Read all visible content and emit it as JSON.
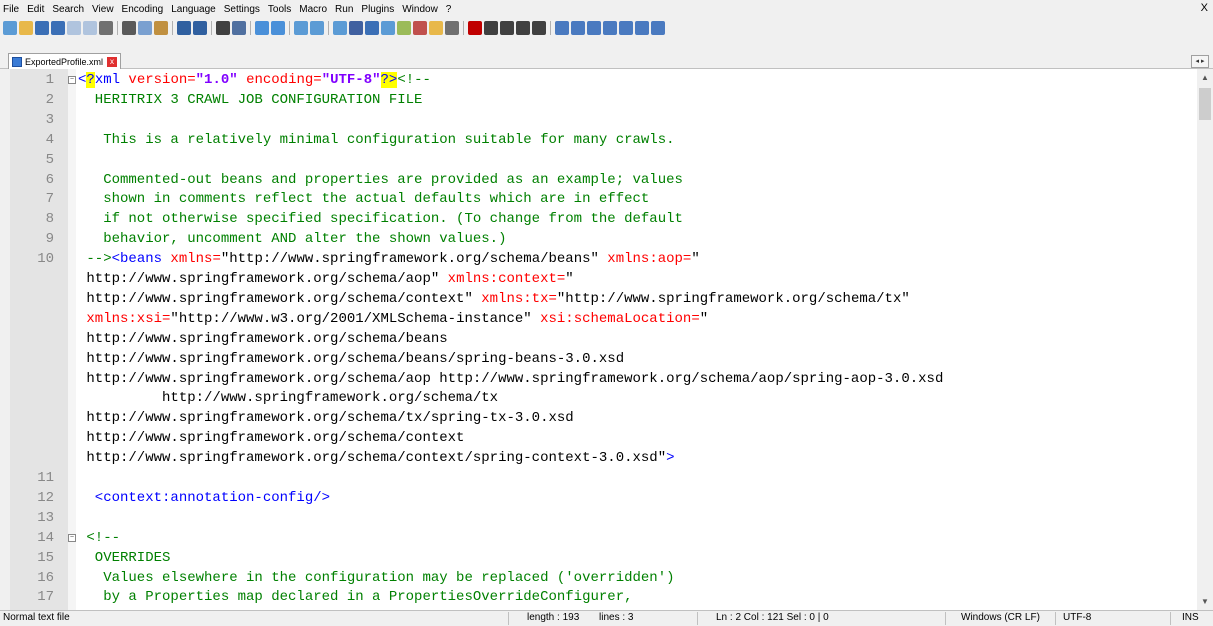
{
  "menu": [
    "File",
    "Edit",
    "Search",
    "View",
    "Encoding",
    "Language",
    "Settings",
    "Tools",
    "Macro",
    "Run",
    "Plugins",
    "Window",
    "?"
  ],
  "window_close": "X",
  "toolbar_icons": [
    {
      "name": "new-file-icon",
      "color": "#5b9bd5"
    },
    {
      "name": "open-file-icon",
      "color": "#e8b84a"
    },
    {
      "name": "save-icon",
      "color": "#3b6fb6"
    },
    {
      "name": "save-all-icon",
      "color": "#3b6fb6"
    },
    {
      "name": "close-icon",
      "color": "#b0c4de"
    },
    {
      "name": "close-all-icon",
      "color": "#b0c4de"
    },
    {
      "name": "print-icon",
      "color": "#707070"
    },
    {
      "sep": true
    },
    {
      "name": "cut-icon",
      "color": "#5a5a5a"
    },
    {
      "name": "copy-icon",
      "color": "#7aa0d0"
    },
    {
      "name": "paste-icon",
      "color": "#c09040"
    },
    {
      "sep": true
    },
    {
      "name": "undo-icon",
      "color": "#3060a0"
    },
    {
      "name": "redo-icon",
      "color": "#3060a0"
    },
    {
      "sep": true
    },
    {
      "name": "find-icon",
      "color": "#404040"
    },
    {
      "name": "replace-icon",
      "color": "#5070a0"
    },
    {
      "sep": true
    },
    {
      "name": "zoom-in-icon",
      "color": "#4a90d9"
    },
    {
      "name": "zoom-out-icon",
      "color": "#4a90d9"
    },
    {
      "sep": true
    },
    {
      "name": "sync-vertical-icon",
      "color": "#5b9bd5"
    },
    {
      "name": "sync-horizontal-icon",
      "color": "#5b9bd5"
    },
    {
      "sep": true
    },
    {
      "name": "word-wrap-icon",
      "color": "#5b9bd5"
    },
    {
      "name": "show-all-chars-icon",
      "color": "#4060a0"
    },
    {
      "name": "indent-guide-icon",
      "color": "#3b6fb6"
    },
    {
      "name": "doc-map-icon",
      "color": "#5b9bd5"
    },
    {
      "name": "function-list-icon",
      "color": "#9bbb59"
    },
    {
      "name": "folder-workspace-icon",
      "color": "#c0504d"
    },
    {
      "name": "monitoring-icon",
      "color": "#e8b84a"
    },
    {
      "name": "view-icon",
      "color": "#707070"
    },
    {
      "sep": true
    },
    {
      "name": "record-macro-icon",
      "color": "#c00000"
    },
    {
      "name": "stop-record-icon",
      "color": "#404040"
    },
    {
      "name": "playback-icon",
      "color": "#404040"
    },
    {
      "name": "run-macro-multiple-icon",
      "color": "#404040"
    },
    {
      "name": "save-macro-icon",
      "color": "#404040"
    },
    {
      "sep": true
    },
    {
      "name": "plugin-a-icon",
      "color": "#4a7ac0"
    },
    {
      "name": "plugin-b-icon",
      "color": "#4a7ac0"
    },
    {
      "name": "plugin-c-icon",
      "color": "#4a7ac0"
    },
    {
      "name": "plugin-d-icon",
      "color": "#4a7ac0"
    },
    {
      "name": "plugin-e-icon",
      "color": "#4a7ac0"
    },
    {
      "name": "plugin-f-icon",
      "color": "#4a7ac0"
    },
    {
      "name": "plugin-g-icon",
      "color": "#4a7ac0"
    }
  ],
  "tab": {
    "label": "ExportedProfile.xml",
    "close_label": "x",
    "scroll_arrows": "◂ ▸"
  },
  "scroll": {
    "up": "▲",
    "down": "▼"
  },
  "lines": [
    {
      "n": "1",
      "fold": "−",
      "segs": [
        {
          "t": "<",
          "c": "c-tag"
        },
        {
          "t": "?",
          "c": "c-tag hl"
        },
        {
          "t": "xml",
          "c": "c-tag"
        },
        {
          "t": " version=",
          "c": "c-attr"
        },
        {
          "t": "\"1.0\"",
          "c": "c-val"
        },
        {
          "t": " encoding=",
          "c": "c-attr"
        },
        {
          "t": "\"UTF-8\"",
          "c": "c-val"
        },
        {
          "t": "?>",
          "c": "c-tag hl"
        },
        {
          "t": "<!--",
          "c": "c-comment"
        }
      ]
    },
    {
      "n": "2",
      "segs": [
        {
          "t": "  HERITRIX 3 CRAWL JOB CONFIGURATION FILE",
          "c": "c-comment"
        }
      ]
    },
    {
      "n": "3",
      "segs": []
    },
    {
      "n": "4",
      "segs": [
        {
          "t": "   This is a relatively minimal configuration suitable for many crawls.",
          "c": "c-comment"
        }
      ]
    },
    {
      "n": "5",
      "segs": []
    },
    {
      "n": "6",
      "segs": [
        {
          "t": "   Commented-out beans and properties are provided as an example; values",
          "c": "c-comment"
        }
      ]
    },
    {
      "n": "7",
      "segs": [
        {
          "t": "   shown in comments reflect the actual defaults which are in effect",
          "c": "c-comment"
        }
      ]
    },
    {
      "n": "8",
      "segs": [
        {
          "t": "   if not otherwise specified specification. (To change from the default",
          "c": "c-comment"
        }
      ]
    },
    {
      "n": "9",
      "segs": [
        {
          "t": "   behavior, uncomment AND alter the shown values.)",
          "c": "c-comment"
        }
      ]
    },
    {
      "n": "10",
      "segs": [
        {
          "t": " -->",
          "c": "c-comment"
        },
        {
          "t": "<beans",
          "c": "c-tag"
        },
        {
          "t": " xmlns=",
          "c": "c-attr"
        },
        {
          "t": "\"http://www.springframework.org/schema/beans\"",
          "c": "c-plain"
        },
        {
          "t": " xmlns:aop=",
          "c": "c-attr"
        },
        {
          "t": "\"",
          "c": "c-plain"
        }
      ]
    },
    {
      "n": "",
      "segs": [
        {
          "t": " http://www.springframework.org/schema/aop\"",
          "c": "c-plain"
        },
        {
          "t": " xmlns:context=",
          "c": "c-attr"
        },
        {
          "t": "\"",
          "c": "c-plain"
        }
      ]
    },
    {
      "n": "",
      "segs": [
        {
          "t": " http://www.springframework.org/schema/context\"",
          "c": "c-plain"
        },
        {
          "t": " xmlns:tx=",
          "c": "c-attr"
        },
        {
          "t": "\"http://www.springframework.org/schema/tx\"",
          "c": "c-plain"
        }
      ]
    },
    {
      "n": "",
      "segs": [
        {
          "t": " xmlns:xsi=",
          "c": "c-attr"
        },
        {
          "t": "\"http://www.w3.org/2001/XMLSchema-instance\"",
          "c": "c-plain"
        },
        {
          "t": " xsi:schemaLocation=",
          "c": "c-attr"
        },
        {
          "t": "\"",
          "c": "c-plain"
        }
      ]
    },
    {
      "n": "",
      "segs": [
        {
          "t": " http://www.springframework.org/schema/beans",
          "c": "c-plain"
        }
      ]
    },
    {
      "n": "",
      "segs": [
        {
          "t": " http://www.springframework.org/schema/beans/spring-beans-3.0.xsd",
          "c": "c-plain"
        }
      ]
    },
    {
      "n": "",
      "segs": [
        {
          "t": " http://www.springframework.org/schema/aop http://www.springframework.org/schema/aop/spring-aop-3.0.xsd",
          "c": "c-plain"
        }
      ]
    },
    {
      "n": "",
      "segs": [
        {
          "t": "          http://www.springframework.org/schema/tx",
          "c": "c-plain"
        }
      ]
    },
    {
      "n": "",
      "segs": [
        {
          "t": " http://www.springframework.org/schema/tx/spring-tx-3.0.xsd",
          "c": "c-plain"
        }
      ]
    },
    {
      "n": "",
      "segs": [
        {
          "t": " http://www.springframework.org/schema/context",
          "c": "c-plain"
        }
      ]
    },
    {
      "n": "",
      "segs": [
        {
          "t": " http://www.springframework.org/schema/context/spring-context-3.0.xsd\"",
          "c": "c-plain"
        },
        {
          "t": ">",
          "c": "c-tag"
        }
      ]
    },
    {
      "n": "11",
      "segs": []
    },
    {
      "n": "12",
      "segs": [
        {
          "t": "  <context:annotation-config/>",
          "c": "c-tag"
        }
      ]
    },
    {
      "n": "13",
      "segs": []
    },
    {
      "n": "14",
      "fold": "−",
      "segs": [
        {
          "t": " <!--",
          "c": "c-comment"
        }
      ]
    },
    {
      "n": "15",
      "segs": [
        {
          "t": "  OVERRIDES",
          "c": "c-comment"
        }
      ]
    },
    {
      "n": "16",
      "segs": [
        {
          "t": "   Values elsewhere in the configuration may be replaced ('overridden')",
          "c": "c-comment"
        }
      ]
    },
    {
      "n": "17",
      "segs": [
        {
          "t": "   by a Properties map declared in a PropertiesOverrideConfigurer,",
          "c": "c-comment"
        }
      ]
    }
  ],
  "status": {
    "file_type": "Normal text file",
    "length": "length : 193",
    "lines": "lines : 3",
    "position": "Ln : 2   Col : 121   Sel : 0 | 0",
    "eol": "Windows (CR LF)",
    "encoding": "UTF-8",
    "mode": "INS"
  }
}
